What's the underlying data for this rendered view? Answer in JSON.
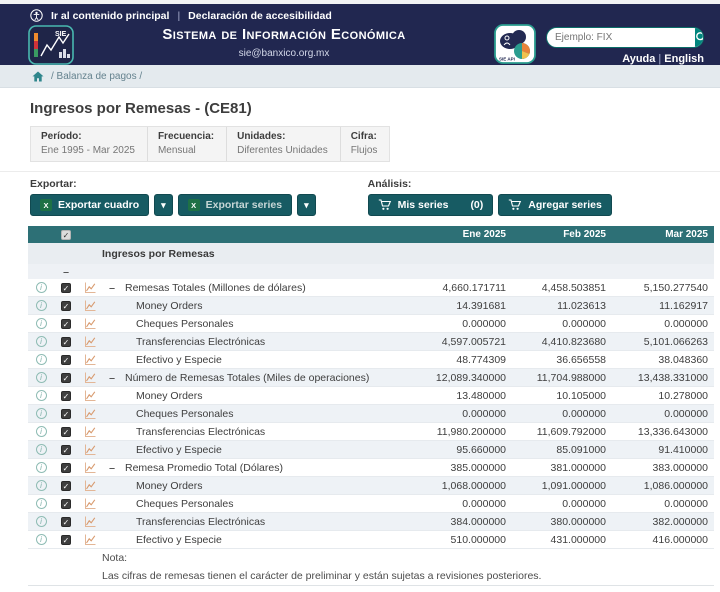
{
  "topbar": {
    "skip_link": "Ir al contenido principal",
    "divider": "|",
    "accessibility_link": "Declaración de accesibilidad"
  },
  "header": {
    "title": "Sistema de Información Económica",
    "email": "sie@banxico.org.mx",
    "search_placeholder": "Ejemplo: FIX",
    "help_label": "Ayuda",
    "link_divider": "|",
    "lang_label": "English"
  },
  "breadcrumb": {
    "path": "/ Balanza de pagos /"
  },
  "page": {
    "title": "Ingresos por Remesas - (CE81)"
  },
  "filters": [
    {
      "label": "Período:",
      "value": "Ene 1995 - Mar 2025"
    },
    {
      "label": "Frecuencia:",
      "value": "Mensual"
    },
    {
      "label": "Unidades:",
      "value": "Diferentes Unidades"
    },
    {
      "label": "Cifra:",
      "value": "Flujos"
    }
  ],
  "toolbar": {
    "export_label": "Exportar:",
    "export_table_label": "Exportar cuadro",
    "export_series_label": "Exportar series",
    "caret": "▾",
    "analysis_label": "Análisis:",
    "my_series_label": "Mis series",
    "my_series_count": "(0)",
    "add_series_label": "Agregar series"
  },
  "table": {
    "columns": [
      "Ene 2025",
      "Feb 2025",
      "Mar 2025"
    ],
    "group_title": "Ingresos por Remesas",
    "collapse_symbol": "–",
    "rows": [
      {
        "level": 0,
        "label": "Remesas Totales (Millones de dólares)",
        "values": [
          "4,660.171711",
          "4,458.503851",
          "5,150.277540"
        ]
      },
      {
        "level": 1,
        "label": "Money Orders",
        "values": [
          "14.391681",
          "11.023613",
          "11.162917"
        ]
      },
      {
        "level": 1,
        "label": "Cheques Personales",
        "values": [
          "0.000000",
          "0.000000",
          "0.000000"
        ]
      },
      {
        "level": 1,
        "label": "Transferencias Electrónicas",
        "values": [
          "4,597.005721",
          "4,410.823680",
          "5,101.066263"
        ]
      },
      {
        "level": 1,
        "label": "Efectivo y Especie",
        "values": [
          "48.774309",
          "36.656558",
          "38.048360"
        ]
      },
      {
        "level": 0,
        "label": "Número de Remesas Totales (Miles de operaciones)",
        "values": [
          "12,089.340000",
          "11,704.988000",
          "13,438.331000"
        ]
      },
      {
        "level": 1,
        "label": "Money Orders",
        "values": [
          "13.480000",
          "10.105000",
          "10.278000"
        ]
      },
      {
        "level": 1,
        "label": "Cheques Personales",
        "values": [
          "0.000000",
          "0.000000",
          "0.000000"
        ]
      },
      {
        "level": 1,
        "label": "Transferencias Electrónicas",
        "values": [
          "11,980.200000",
          "11,609.792000",
          "13,336.643000"
        ]
      },
      {
        "level": 1,
        "label": "Efectivo y Especie",
        "values": [
          "95.660000",
          "85.091000",
          "91.410000"
        ]
      },
      {
        "level": 0,
        "label": "Remesa Promedio Total (Dólares)",
        "values": [
          "385.000000",
          "381.000000",
          "383.000000"
        ]
      },
      {
        "level": 1,
        "label": "Money Orders",
        "values": [
          "1,068.000000",
          "1,091.000000",
          "1,086.000000"
        ]
      },
      {
        "level": 1,
        "label": "Cheques Personales",
        "values": [
          "0.000000",
          "0.000000",
          "0.000000"
        ]
      },
      {
        "level": 1,
        "label": "Transferencias Electrónicas",
        "values": [
          "384.000000",
          "380.000000",
          "382.000000"
        ]
      },
      {
        "level": 1,
        "label": "Efectivo y Especie",
        "values": [
          "510.000000",
          "431.000000",
          "416.000000"
        ]
      }
    ]
  },
  "note": {
    "label": "Nota:",
    "text": "Las cifras de remesas tienen el carácter de preliminar y están sujetas a revisiones posteriores."
  },
  "icons": {
    "accessibility": "person-in-circle",
    "search": "magnifier",
    "home": "house",
    "excel": "xls-square",
    "cart": "shopping-cart",
    "info": "circled-i",
    "chart": "mini-line-chart",
    "check": "✓"
  },
  "colors": {
    "navy": "#212750",
    "teal_button": "#175b63",
    "table_header_teal": "#2d7076",
    "search_button_teal": "#00857d",
    "excel_green": "#1e7145",
    "row_stripe": "#eef2f6",
    "breadcrumb_bg": "#e4eaee"
  }
}
